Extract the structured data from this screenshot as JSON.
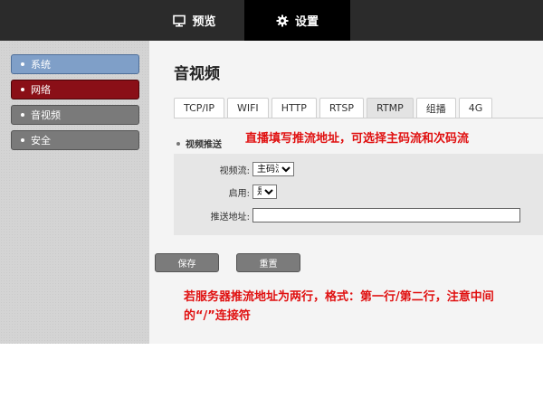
{
  "topbar": {
    "preview_label": "预览",
    "settings_label": "设置",
    "icons": {
      "preview": "monitor-icon",
      "settings": "gear-icon"
    }
  },
  "sidebar": {
    "items": [
      {
        "label": "系统",
        "state": "highlighted"
      },
      {
        "label": "网络",
        "state": "active"
      },
      {
        "label": "音视频",
        "state": "normal"
      },
      {
        "label": "安全",
        "state": "normal"
      }
    ]
  },
  "main": {
    "title": "音视频",
    "tabs": [
      {
        "label": "TCP/IP"
      },
      {
        "label": "WIFI"
      },
      {
        "label": "HTTP"
      },
      {
        "label": "RTSP"
      },
      {
        "label": "RTMP",
        "active": true
      },
      {
        "label": "组播"
      },
      {
        "label": "4G"
      }
    ],
    "section_label": "视频推送",
    "form": {
      "stream_label": "视频流:",
      "stream_value": "主码流",
      "enable_label": "启用:",
      "enable_value": "是",
      "url_label": "推送地址:",
      "url_value": ""
    },
    "buttons": {
      "save": "保存",
      "reset": "重置"
    }
  },
  "annotations": {
    "top": "直播填写推流地址，可选择主码流和次码流",
    "bottom": "若服务器推流地址为两行，格式：第一行/第二行，注意中间的“/”连接符",
    "color": "#e01010"
  },
  "colors": {
    "topbar": "#2b2b2b",
    "settings_tab": "#000000",
    "sidebar_active": "#8a0f17",
    "sidebar_highlight": "#7f9fc8"
  }
}
